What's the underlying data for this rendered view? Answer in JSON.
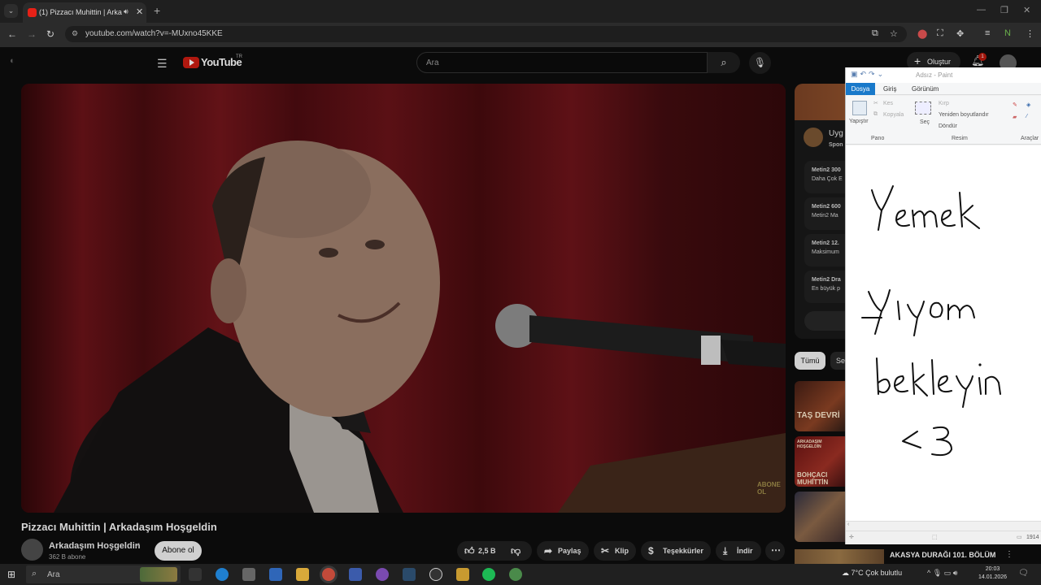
{
  "browser": {
    "tab_title": "(1) Pizzacı Muhittin | Arkada",
    "url": "youtube.com/watch?v=-MUxno45KKE",
    "new_tab": "+",
    "tab_menu": "⌄"
  },
  "youtube": {
    "logo_text": "YouTube",
    "country": "TR",
    "search_placeholder": "Ara",
    "create_label": "Oluştur",
    "notification_count": "1",
    "video": {
      "title": "Pizzacı Muhittin | Arkadaşım Hoşgeldin",
      "watermark": "ABONE OL"
    },
    "channel": {
      "name": "Arkadaşım Hoşgeldin",
      "subscribers": "362 B abone",
      "subscribe_label": "Abone ol"
    },
    "actions": {
      "likes": "2,5 B",
      "share": "Paylaş",
      "clip": "Klip",
      "thanks": "Teşekkürler",
      "download": "İndir"
    },
    "sidebar": {
      "ad_title": "Uyg",
      "ad_sponsor": "Spon",
      "ad_rows": [
        {
          "a": "Metin2 300",
          "b": "Daha Çok E"
        },
        {
          "a": "Metin2 600",
          "b": "Metin2 Ma"
        },
        {
          "a": "Metin2 12.",
          "b": "Maksimum"
        },
        {
          "a": "Metin2 Dra",
          "b": "En büyük p"
        }
      ],
      "chip_all": "Tümü",
      "chip_second": "Se",
      "thumbs": [
        {
          "caption": "TAŞ DEVRİ"
        },
        {
          "caption_top": "ARKADAŞIM HOŞGELDİN",
          "caption": "BOHÇACI MUHİTTİN"
        },
        {
          "caption": ""
        }
      ],
      "bottom_video_title": "AKASYA DURAĞI 101. BÖLÜM"
    }
  },
  "paint": {
    "window_title": "Adsız - Paint",
    "tabs": [
      "Dosya",
      "Giriş",
      "Görünüm"
    ],
    "ribbon": {
      "paste": "Yapıştır",
      "cut": "Kes",
      "copy": "Kopyala",
      "clipboard_group": "Pano",
      "select": "Seç",
      "crop": "Kırp",
      "resize": "Yeniden boyutlandır",
      "rotate": "Döndür",
      "image_group": "Resim",
      "tools_group": "Araçlar"
    },
    "handwriting": [
      "Yemek",
      "Yiyom",
      "bekleyin",
      "<3"
    ],
    "status_size": "1914"
  },
  "taskbar": {
    "search_placeholder": "Ara",
    "weather": "7°C  Çok bulutlu",
    "time": "20:03",
    "date": "14.01.2026"
  },
  "colors": {
    "youtube_red": "#e62117",
    "paint_blue": "#1979ca"
  }
}
